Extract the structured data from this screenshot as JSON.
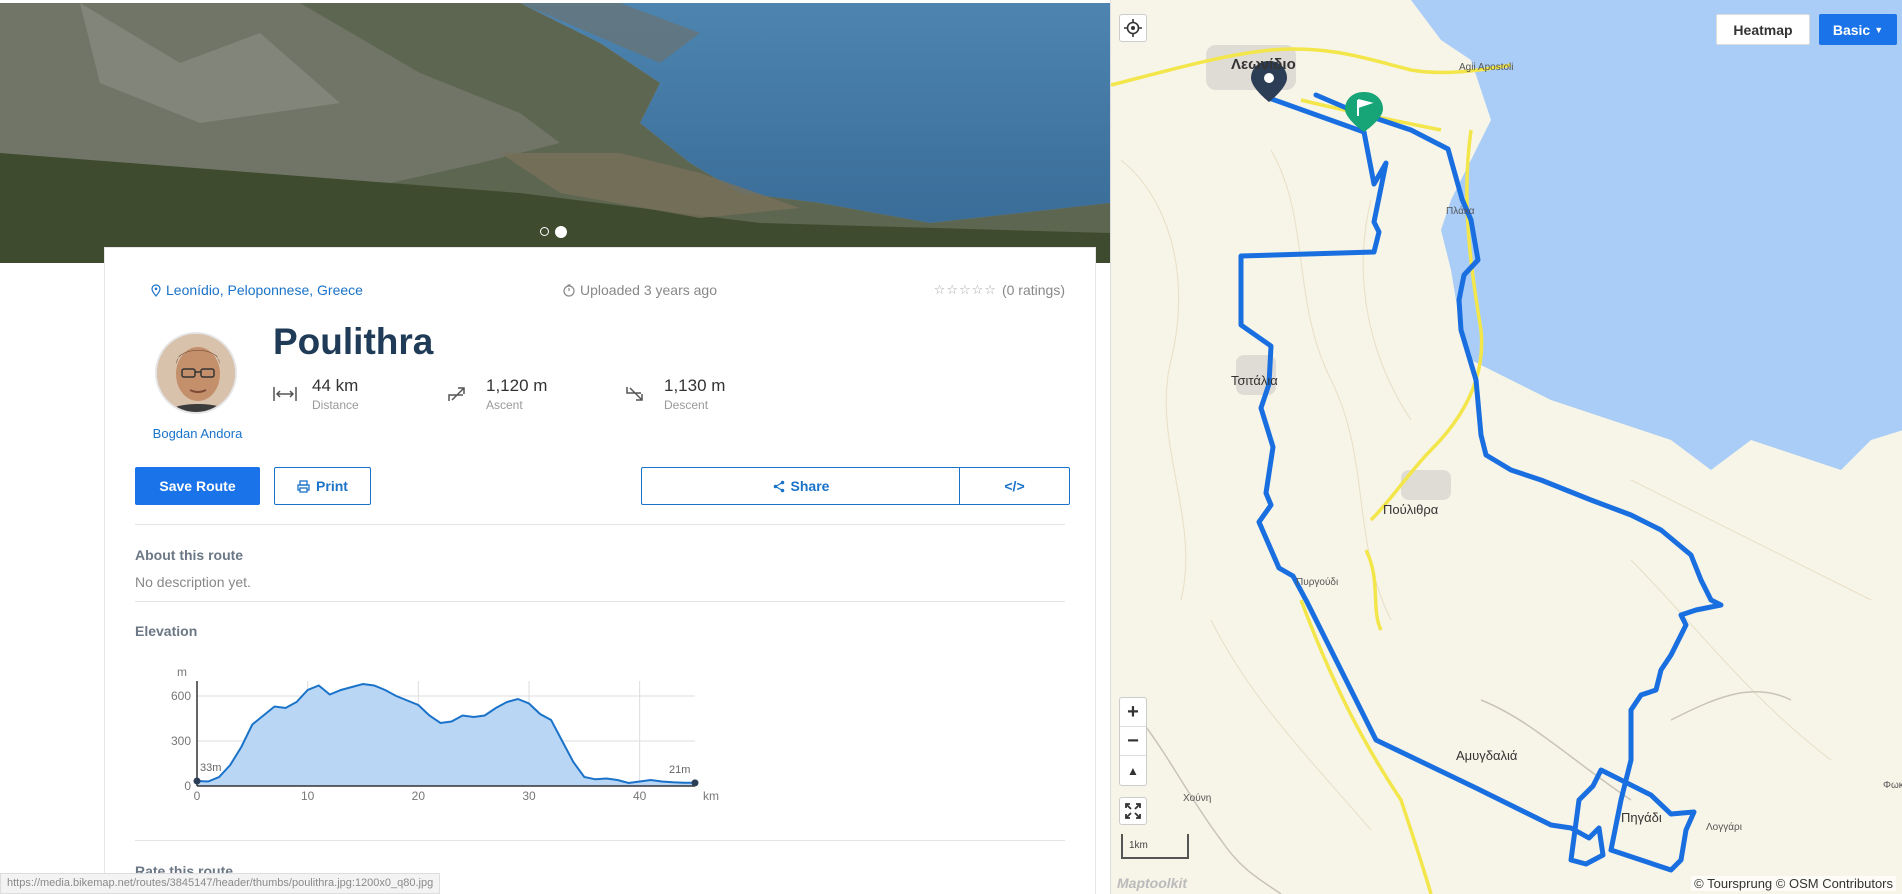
{
  "route": {
    "location": "Leonídio, Peloponnese, Greece",
    "uploaded": "Uploaded 3 years ago",
    "ratings": "(0 ratings)",
    "stars": "☆☆☆☆☆",
    "title": "Poulithra",
    "author": "Bogdan Andora",
    "stats": {
      "distance": {
        "value": "44 km",
        "label": "Distance"
      },
      "ascent": {
        "value": "1,120 m",
        "label": "Ascent"
      },
      "descent": {
        "value": "1,130 m",
        "label": "Descent"
      }
    }
  },
  "actions": {
    "save": "Save Route",
    "print": "Print",
    "share": "Share",
    "embed": "</>"
  },
  "about": {
    "title": "About this route",
    "text": "No description yet."
  },
  "elevation": {
    "title": "Elevation",
    "unit_y": "m",
    "unit_x": "km",
    "start_label": "33m",
    "end_label": "21m"
  },
  "rate": {
    "title": "Rate this route"
  },
  "status_url": "https://media.bikemap.net/routes/3845147/header/thumbs/poulithra.jpg:1200x0_q80.jpg",
  "map": {
    "heatmap": "Heatmap",
    "basic": "Basic",
    "zoom_in": "+",
    "zoom_out": "−",
    "north": "▲",
    "scale": "1km",
    "attribution": "© Toursprung © OSM Contributors",
    "brand": "Maptoolkit",
    "places": {
      "leonidio": "Λεωνίδιο",
      "agii": "Agii Apostoli",
      "plaka": "Πλάκα",
      "tsitalia": "Τσιτάλια",
      "poulithra": "Πούλιθρα",
      "pyrgoudi": "Πυργούδι",
      "amygdalia": "Αμυγδαλιά",
      "pigadi": "Πηγάδι",
      "chouni": "Χούνη",
      "loggari": "Λογγάρι",
      "foki": "Φωκ"
    }
  },
  "chart_data": {
    "type": "area",
    "title": "Elevation",
    "xlabel": "km",
    "ylabel": "m",
    "xlim": [
      0,
      45
    ],
    "ylim": [
      0,
      700
    ],
    "xticks": [
      0,
      10,
      20,
      30,
      40
    ],
    "yticks": [
      0,
      300,
      600
    ],
    "x": [
      0,
      1,
      2,
      3,
      4,
      5,
      6,
      7,
      8,
      9,
      10,
      11,
      12,
      13,
      14,
      15,
      16,
      17,
      18,
      19,
      20,
      21,
      22,
      23,
      24,
      25,
      26,
      27,
      28,
      29,
      30,
      31,
      32,
      33,
      34,
      35,
      36,
      37,
      38,
      39,
      40,
      41,
      42,
      43,
      44,
      45
    ],
    "series": [
      {
        "values": [
          33,
          30,
          60,
          140,
          260,
          410,
          470,
          530,
          520,
          560,
          640,
          670,
          610,
          640,
          660,
          680,
          670,
          640,
          600,
          570,
          540,
          470,
          420,
          430,
          470,
          460,
          470,
          520,
          560,
          580,
          550,
          480,
          440,
          300,
          160,
          60,
          45,
          50,
          40,
          20,
          30,
          40,
          30,
          25,
          21,
          21
        ]
      }
    ],
    "annotations": [
      "33m",
      "21m"
    ],
    "grid": true
  }
}
